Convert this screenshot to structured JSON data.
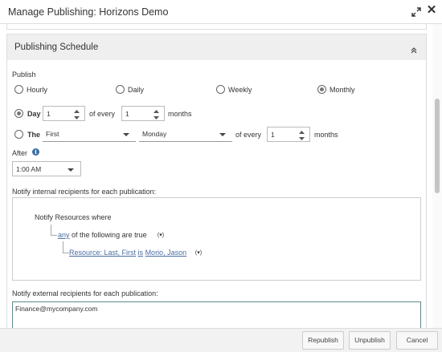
{
  "dialog": {
    "title": "Manage Publishing: Horizons Demo"
  },
  "schedule": {
    "section_title": "Publishing Schedule",
    "publish_label": "Publish",
    "frequency_options": [
      {
        "label": "Hourly",
        "selected": false
      },
      {
        "label": "Daily",
        "selected": false
      },
      {
        "label": "Weekly",
        "selected": false
      },
      {
        "label": "Monthly",
        "selected": true
      }
    ],
    "day_option": {
      "label": "Day",
      "selected": true,
      "day_value": "1",
      "of_every_label": "of every",
      "months_value": "1",
      "months_label": "months"
    },
    "the_option": {
      "label": "The",
      "selected": false,
      "ordinal_value": "First",
      "weekday_value": "Monday",
      "of_every_label": "of every",
      "months_value": "1",
      "months_label": "months"
    },
    "after_label": "After",
    "after_time": "1:00 AM"
  },
  "internal_notify": {
    "label": "Notify internal recipients for each publication:",
    "rule_root": "Notify Resources where",
    "quantifier_link": "any",
    "quantifier_rest": "of the following are true",
    "condition_field": "Resource: Last, First",
    "condition_operator": "is",
    "condition_value": "Morio, Jason",
    "filter_caret": "(▾)"
  },
  "external_notify": {
    "label": "Notify external recipients for each publication:",
    "value": "Finance@mycompany.com"
  },
  "footer": {
    "republish_label": "Republish",
    "unpublish_label": "Unpublish",
    "cancel_label": "Cancel"
  },
  "icons": {
    "expand": "expand-icon",
    "close": "close-icon",
    "collapse": "chevron-double-up-icon",
    "info": "info-icon"
  },
  "colors": {
    "link": "#4a6fa5",
    "info_icon": "#3a6ea5",
    "panel_header": "#efefef"
  }
}
